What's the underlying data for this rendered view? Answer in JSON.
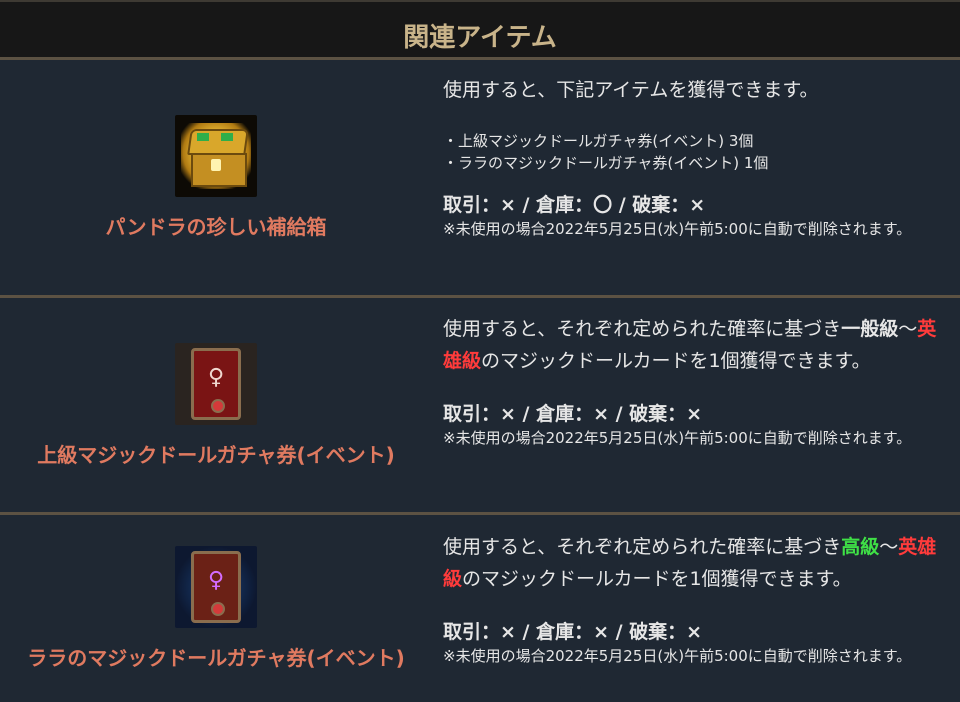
{
  "header": {
    "title": "関連アイテム"
  },
  "items": [
    {
      "icon": "treasure-chest-icon",
      "name": "パンドラの珍しい補給箱",
      "desc_plain": "使用すると、下記アイテムを獲得できます。",
      "contents": [
        "・上級マジックドールガチャ券(イベント) 3個",
        "・ララのマジックドールガチャ券(イベント) 1個"
      ],
      "trade": "取引：×  /  倉庫：〇  /  破棄：×",
      "note": "※未使用の場合2022年5月25日(水)午前5:00に自動で削除されます。"
    },
    {
      "icon": "magic-doll-card-icon",
      "name": "上級マジックドールガチャ券(イベント)",
      "desc_a": "使用すると、それぞれ定められた確率に基づき",
      "desc_grade1": "一般級",
      "desc_b": "～",
      "desc_grade2": "英雄級",
      "desc_c": "のマジックドールカードを1個獲得できます。",
      "trade": "取引：×  /  倉庫：×  /  破棄：×",
      "note": "※未使用の場合2022年5月25日(水)午前5:00に自動で削除されます。"
    },
    {
      "icon": "lara-doll-card-icon",
      "name": "ララのマジックドールガチャ券(イベント)",
      "desc_a": "使用すると、それぞれ定められた確率に基づき",
      "desc_grade1": "高級",
      "desc_b": "～",
      "desc_grade2": "英雄級",
      "desc_c": "のマジックドールカードを1個獲得できます。",
      "trade": "取引：×  /  倉庫：×  /  破棄：×",
      "note": "※未使用の場合2022年5月25日(水)午前5:00に自動で削除されます。"
    }
  ],
  "colors": {
    "item_name": "#e07a60",
    "hero_grade": "#ff3b3b",
    "high_grade": "#3fe046",
    "header_text": "#c9b48a"
  }
}
